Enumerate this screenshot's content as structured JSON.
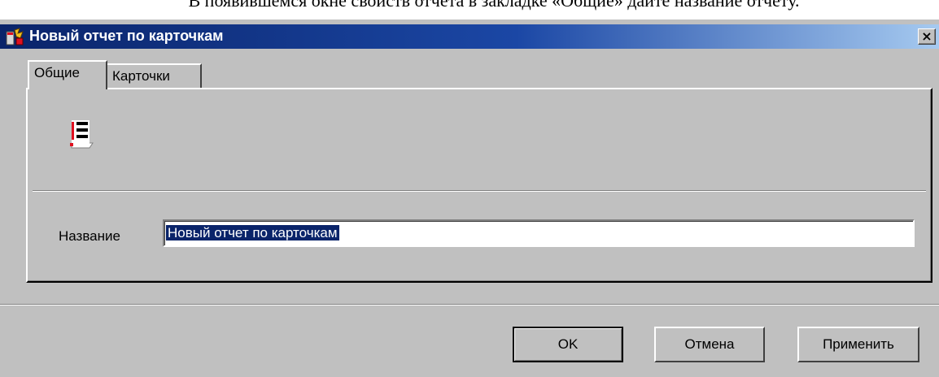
{
  "caption": "В появившемся окне свойств отчета в закладке «Общие» дайте название отчету.",
  "window": {
    "title": "Новый отчет по карточкам",
    "app_icon": "report-wizard-icon",
    "close_label": "×"
  },
  "tabs": [
    {
      "label": "Общие",
      "selected": true
    },
    {
      "label": "Карточки",
      "selected": false
    }
  ],
  "general_tab": {
    "icon": "report-list-icon",
    "name_label": "Название",
    "name_value": "Новый отчет по карточкам"
  },
  "buttons": {
    "ok": "OK",
    "cancel": "Отмена",
    "apply": "Применить"
  },
  "colors": {
    "titlebar_start": "#0a246a",
    "titlebar_end": "#a6caf0",
    "selection": "#0a246a",
    "window_bg": "#c0c0c0",
    "icon_red": "#e01020"
  }
}
